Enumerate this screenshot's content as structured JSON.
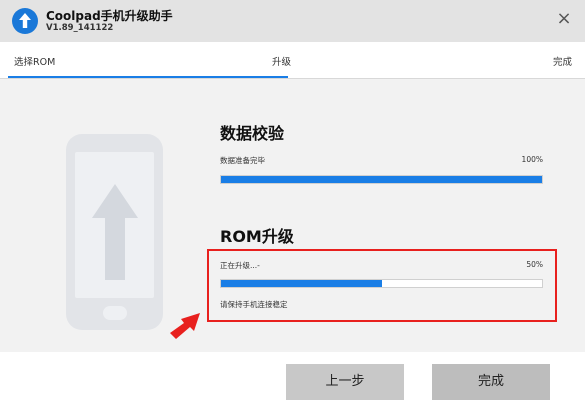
{
  "window": {
    "title": "Coolpad手机升级助手",
    "version": "V1.89_141122",
    "close_label": "×",
    "brand_color": "#1a78d8"
  },
  "steps": {
    "items": [
      {
        "label": "选择ROM"
      },
      {
        "label": "升级"
      },
      {
        "label": "完成"
      }
    ],
    "active_index": 1
  },
  "verify": {
    "title": "数据校验",
    "status": "数据准备完毕",
    "percent_label": "100%",
    "progress": 1.0
  },
  "upgrade": {
    "title": "ROM升级",
    "status": "正在升级...-",
    "percent_label": "50%",
    "progress": 0.5,
    "note": "请保持手机连接稳定"
  },
  "buttons": {
    "prev_label": "上一步",
    "done_label": "完成"
  },
  "annotation": {
    "highlight_color": "#e8201e"
  }
}
